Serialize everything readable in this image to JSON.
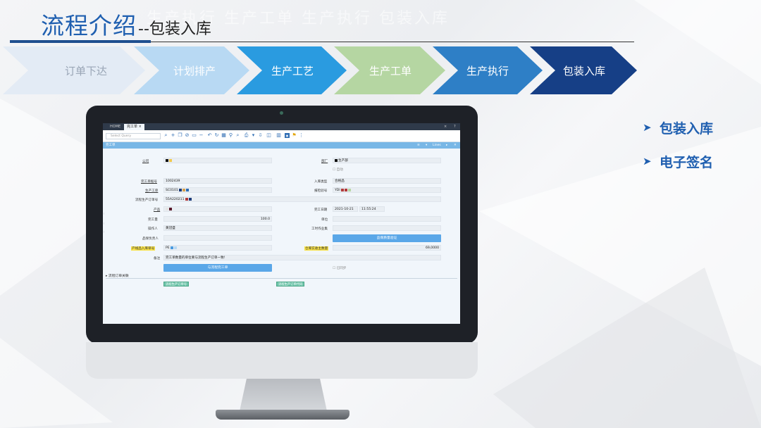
{
  "slide": {
    "title_main": "流程介绍",
    "title_sub": "--包装入库",
    "title_ghost": "生产执行   生产工单   生产执行   包装入库"
  },
  "steps": [
    {
      "label": "订单下达",
      "color": "#e3ebf5",
      "text_color": "#9aa6b6"
    },
    {
      "label": "计划排产",
      "color": "#b8d9f3",
      "text_color": "#ffffff"
    },
    {
      "label": "生产工艺",
      "color": "#2a9be0",
      "text_color": "#ffffff"
    },
    {
      "label": "生产工单",
      "color": "#b5d6a2",
      "text_color": "#ffffff"
    },
    {
      "label": "生产执行",
      "color": "#2e7fc6",
      "text_color": "#ffffff"
    },
    {
      "label": "包装入库",
      "color": "#163f86",
      "text_color": "#ffffff"
    }
  ],
  "bullets": [
    {
      "label": "包装入库"
    },
    {
      "label": "电子签名"
    }
  ],
  "app": {
    "tabs": [
      {
        "label": "HOME"
      },
      {
        "label": "完工单"
      }
    ],
    "tab_close": "×",
    "search_placeholder": "Select Query",
    "form_title": "完工单",
    "form_controls": [
      "≡",
      "▾",
      "Lines",
      "▸",
      "✕"
    ],
    "window_controls": [
      "×",
      "?"
    ],
    "fields": {
      "company_label": "公司",
      "factory_label": "部厂",
      "factory_value": "生产部",
      "auto_label": "自动",
      "doc_no_label": "完工单据号",
      "doc_no_value": "1002439",
      "store_type_label": "入库类型",
      "store_type_value": "合格品",
      "work_order_label": "生产工单",
      "work_order_value": "SC0101",
      "report_label": "报检验号",
      "report_value": "YDI",
      "prev_order_label": "流程生产订单号",
      "prev_order_value": "55A220211",
      "product_label": "产品",
      "complete_date_label": "完工日期",
      "complete_date_value": "2021-10-21",
      "complete_time_value": "11:55:24",
      "complete_qty_label": "完工量",
      "complete_qty_value": "100.0",
      "unit_label": "单位",
      "operator_label": "操作人",
      "operator_value": "黄冠盛",
      "workgroup_label": "工时作业集",
      "quality_label": "品保负责人",
      "quality_button": "品保质量验证",
      "pallet_label": "产线品入库单号",
      "pallet_value": "PE",
      "stock_qty_label": "仓库实收主数量",
      "stock_qty_value": "69,0000",
      "remark_label": "备注",
      "remark_value": "完工单数量的单位要与流程生产订单一致!",
      "sync_button": "与流程完工单",
      "synced_label": "已同步",
      "section_label": "▸ 流程订单关联",
      "link_btn_1": "流程生产订单号",
      "link_btn_2": "流程生产订单代码"
    }
  }
}
